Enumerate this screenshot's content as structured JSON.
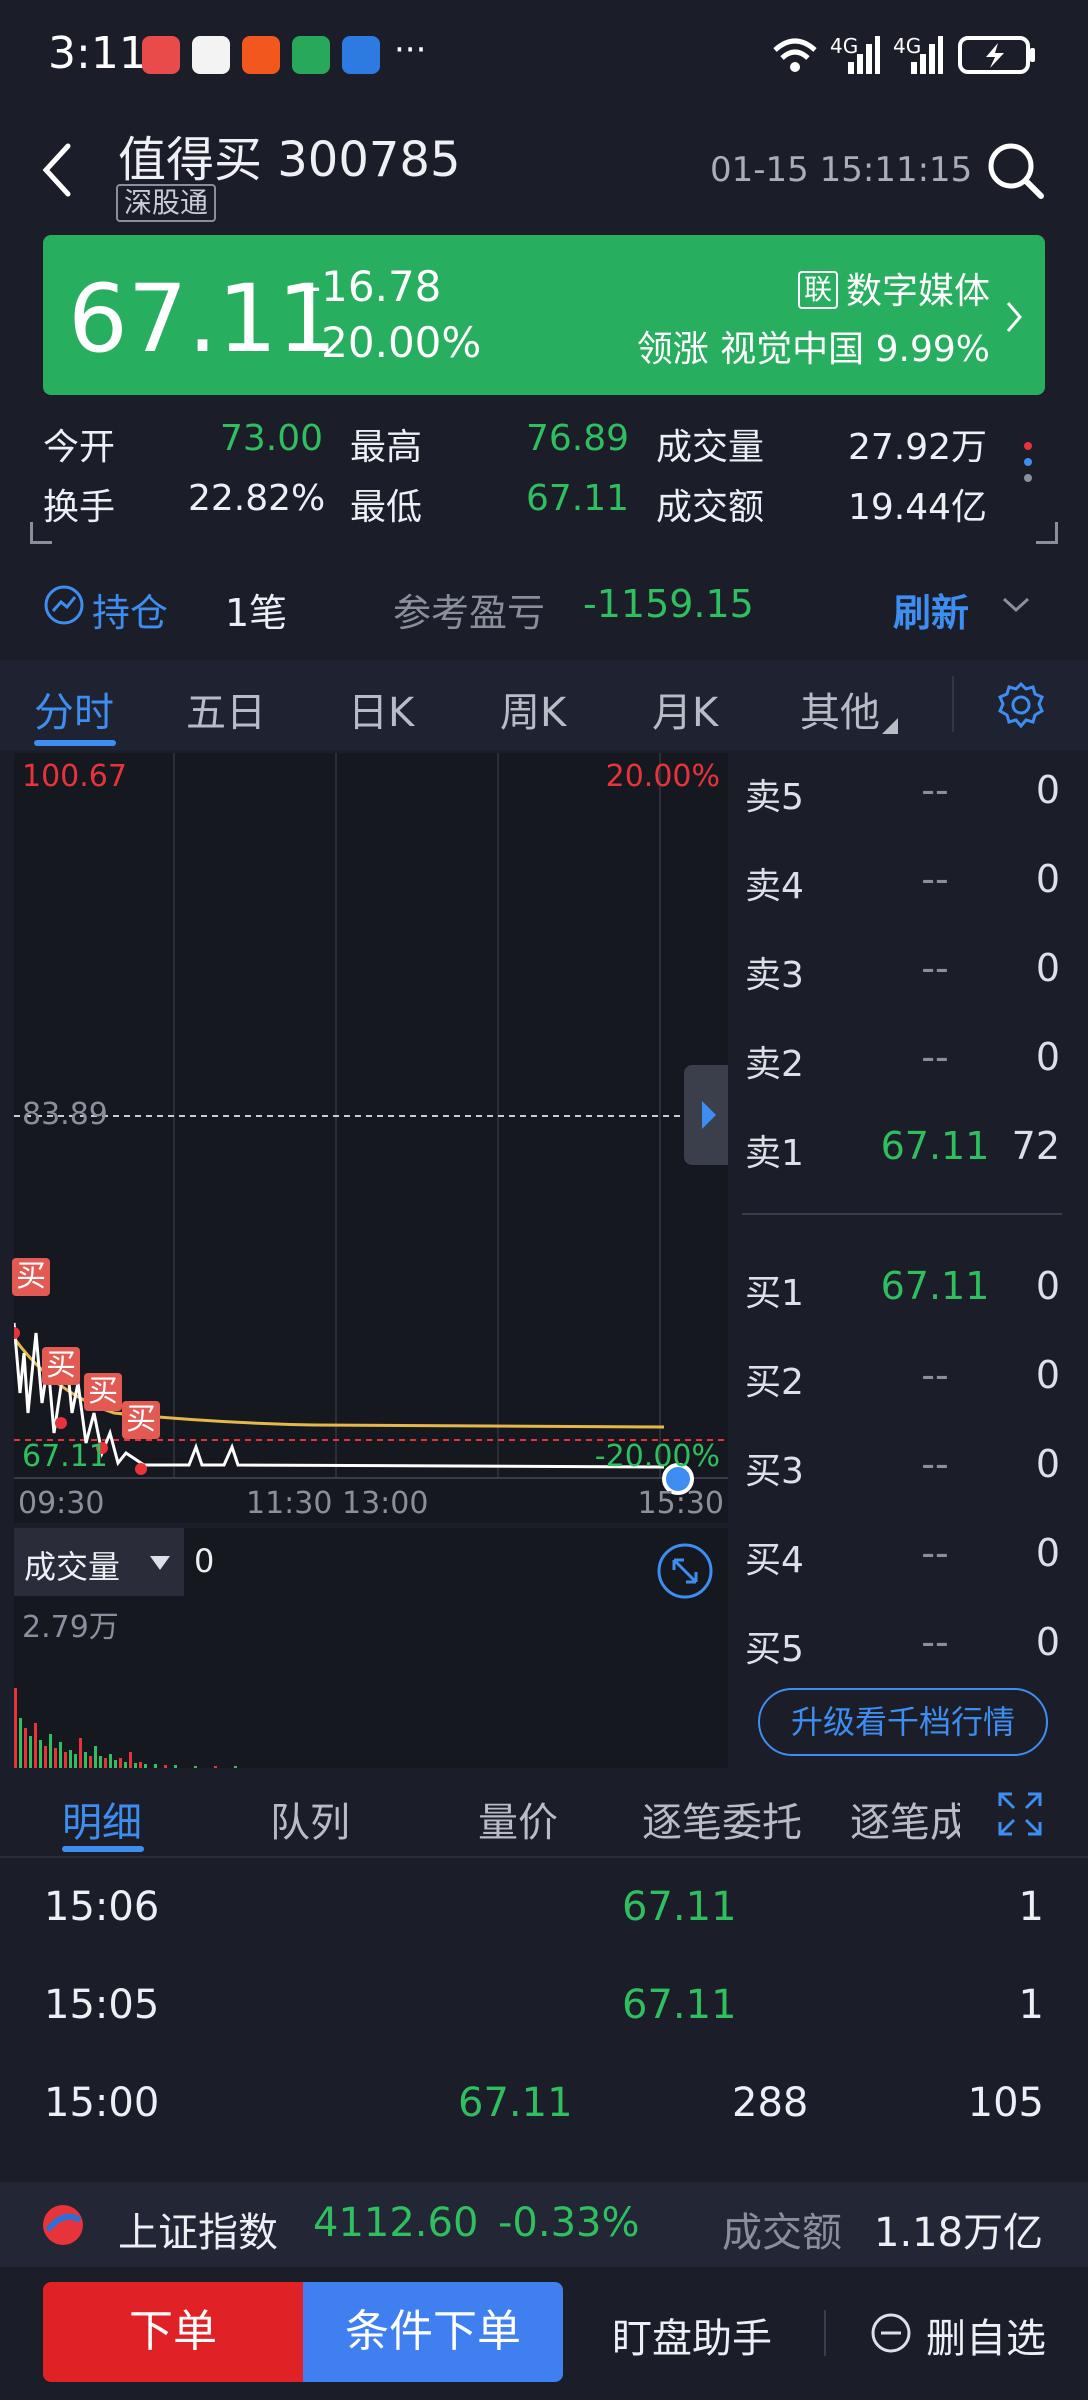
{
  "status_bar": {
    "time": "3:11",
    "more": "···",
    "net1": "4G",
    "net2": "4G"
  },
  "header": {
    "stock_name_code": "值得买 300785",
    "tag": "深股通",
    "datetime": "01-15 15:11:15"
  },
  "banner": {
    "price": "67.11",
    "change": "-16.78",
    "change_pct": "-20.00%",
    "sector_badge": "联",
    "sector": "数字媒体",
    "leader_label": "领涨",
    "leader_name": "视觉中国",
    "leader_pct": "9.99%"
  },
  "stats": {
    "open_label": "今开",
    "open": "73.00",
    "high_label": "最高",
    "high": "76.89",
    "volume_label": "成交量",
    "volume": "27.92万",
    "turnover_label": "换手",
    "turnover": "22.82%",
    "low_label": "最低",
    "low": "67.11",
    "amount_label": "成交额",
    "amount": "19.44亿"
  },
  "position": {
    "label": "持仓",
    "count": "1笔",
    "pnl_label": "参考盈亏",
    "pnl": "-1159.15",
    "refresh": "刷新"
  },
  "tabs": [
    "分时",
    "五日",
    "日K",
    "周K",
    "月K",
    "其他"
  ],
  "chart": {
    "top_price": "100.67",
    "top_pct": "20.00%",
    "mid_price": "83.89",
    "bottom_price": "67.11",
    "bottom_pct": "-20.00%",
    "t_start": "09:30",
    "t_mid": "11:30 13:00",
    "t_end": "15:30",
    "buy_marker": "买",
    "volume_label": "成交量",
    "volume_value": "0",
    "volume_max": "2.79万"
  },
  "order_book": {
    "asks": [
      {
        "label": "卖5",
        "price": "--",
        "vol": "0"
      },
      {
        "label": "卖4",
        "price": "--",
        "vol": "0"
      },
      {
        "label": "卖3",
        "price": "--",
        "vol": "0"
      },
      {
        "label": "卖2",
        "price": "--",
        "vol": "0"
      },
      {
        "label": "卖1",
        "price": "67.11",
        "vol": "72"
      }
    ],
    "bids": [
      {
        "label": "买1",
        "price": "67.11",
        "vol": "0"
      },
      {
        "label": "买2",
        "price": "--",
        "vol": "0"
      },
      {
        "label": "买3",
        "price": "--",
        "vol": "0"
      },
      {
        "label": "买4",
        "price": "--",
        "vol": "0"
      },
      {
        "label": "买5",
        "price": "--",
        "vol": "0"
      }
    ],
    "upgrade": "升级看千档行情"
  },
  "detail_tabs": [
    "明细",
    "队列",
    "量价",
    "逐笔委托",
    "逐笔成"
  ],
  "detail_rows": [
    {
      "time": "15:06",
      "price": "67.11",
      "mid": "",
      "vol": "1"
    },
    {
      "time": "15:05",
      "price": "67.11",
      "mid": "",
      "vol": "1"
    },
    {
      "time": "15:00",
      "price": "67.11",
      "mid": "288",
      "vol": "105"
    }
  ],
  "index_bar": {
    "name": "上证指数",
    "value": "4112.60",
    "pct": "-0.33%",
    "amount_label": "成交额",
    "amount": "1.18万亿"
  },
  "bottom": {
    "order": "下单",
    "cond_order": "条件下单",
    "assistant": "盯盘助手",
    "remove": "删自选"
  }
}
